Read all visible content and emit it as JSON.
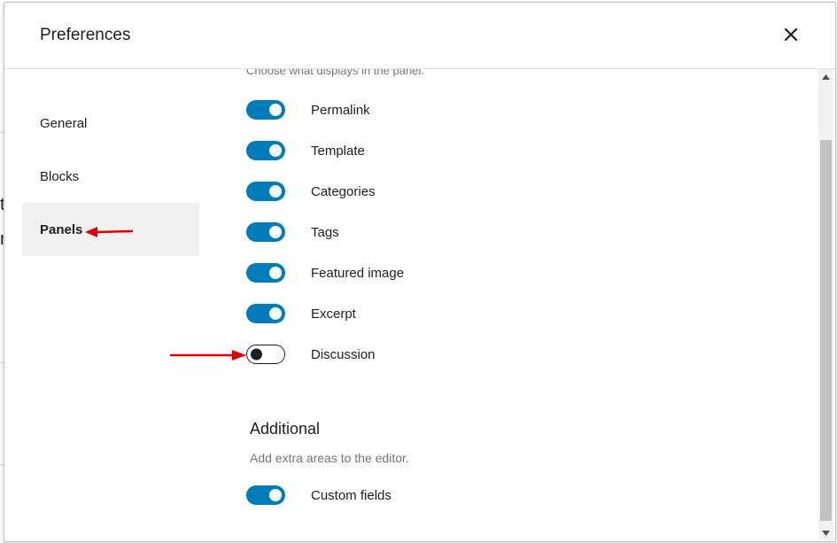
{
  "background": {
    "fragments": [
      "t",
      "n"
    ]
  },
  "modal": {
    "title": "Preferences",
    "close_icon": "close-icon"
  },
  "sidebar": {
    "tabs": [
      {
        "label": "General",
        "active": false
      },
      {
        "label": "Blocks",
        "active": false
      },
      {
        "label": "Panels",
        "active": true
      }
    ]
  },
  "panels": {
    "description": "Choose what displays in the panel.",
    "toggles": [
      {
        "label": "Permalink",
        "enabled": true
      },
      {
        "label": "Template",
        "enabled": true
      },
      {
        "label": "Categories",
        "enabled": true
      },
      {
        "label": "Tags",
        "enabled": true
      },
      {
        "label": "Featured image",
        "enabled": true
      },
      {
        "label": "Excerpt",
        "enabled": true
      },
      {
        "label": "Discussion",
        "enabled": false
      }
    ]
  },
  "additional": {
    "heading": "Additional",
    "description": "Add extra areas to the editor.",
    "toggles": [
      {
        "label": "Custom fields",
        "enabled": true
      }
    ]
  },
  "colors": {
    "toggle_on": "#007cba",
    "annotation_arrow": "#e00000",
    "active_tab_bg": "#f0f0f0"
  }
}
